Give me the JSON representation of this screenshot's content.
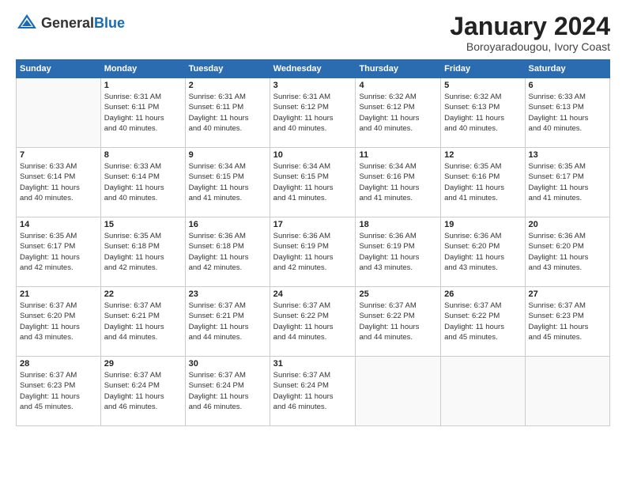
{
  "header": {
    "logo_line1": "General",
    "logo_line2": "Blue",
    "month_title": "January 2024",
    "location": "Boroyaradougou, Ivory Coast"
  },
  "days_of_week": [
    "Sunday",
    "Monday",
    "Tuesday",
    "Wednesday",
    "Thursday",
    "Friday",
    "Saturday"
  ],
  "weeks": [
    [
      {
        "day": "",
        "info": ""
      },
      {
        "day": "1",
        "info": "Sunrise: 6:31 AM\nSunset: 6:11 PM\nDaylight: 11 hours\nand 40 minutes."
      },
      {
        "day": "2",
        "info": "Sunrise: 6:31 AM\nSunset: 6:11 PM\nDaylight: 11 hours\nand 40 minutes."
      },
      {
        "day": "3",
        "info": "Sunrise: 6:31 AM\nSunset: 6:12 PM\nDaylight: 11 hours\nand 40 minutes."
      },
      {
        "day": "4",
        "info": "Sunrise: 6:32 AM\nSunset: 6:12 PM\nDaylight: 11 hours\nand 40 minutes."
      },
      {
        "day": "5",
        "info": "Sunrise: 6:32 AM\nSunset: 6:13 PM\nDaylight: 11 hours\nand 40 minutes."
      },
      {
        "day": "6",
        "info": "Sunrise: 6:33 AM\nSunset: 6:13 PM\nDaylight: 11 hours\nand 40 minutes."
      }
    ],
    [
      {
        "day": "7",
        "info": "Sunrise: 6:33 AM\nSunset: 6:14 PM\nDaylight: 11 hours\nand 40 minutes."
      },
      {
        "day": "8",
        "info": "Sunrise: 6:33 AM\nSunset: 6:14 PM\nDaylight: 11 hours\nand 40 minutes."
      },
      {
        "day": "9",
        "info": "Sunrise: 6:34 AM\nSunset: 6:15 PM\nDaylight: 11 hours\nand 41 minutes."
      },
      {
        "day": "10",
        "info": "Sunrise: 6:34 AM\nSunset: 6:15 PM\nDaylight: 11 hours\nand 41 minutes."
      },
      {
        "day": "11",
        "info": "Sunrise: 6:34 AM\nSunset: 6:16 PM\nDaylight: 11 hours\nand 41 minutes."
      },
      {
        "day": "12",
        "info": "Sunrise: 6:35 AM\nSunset: 6:16 PM\nDaylight: 11 hours\nand 41 minutes."
      },
      {
        "day": "13",
        "info": "Sunrise: 6:35 AM\nSunset: 6:17 PM\nDaylight: 11 hours\nand 41 minutes."
      }
    ],
    [
      {
        "day": "14",
        "info": "Sunrise: 6:35 AM\nSunset: 6:17 PM\nDaylight: 11 hours\nand 42 minutes."
      },
      {
        "day": "15",
        "info": "Sunrise: 6:35 AM\nSunset: 6:18 PM\nDaylight: 11 hours\nand 42 minutes."
      },
      {
        "day": "16",
        "info": "Sunrise: 6:36 AM\nSunset: 6:18 PM\nDaylight: 11 hours\nand 42 minutes."
      },
      {
        "day": "17",
        "info": "Sunrise: 6:36 AM\nSunset: 6:19 PM\nDaylight: 11 hours\nand 42 minutes."
      },
      {
        "day": "18",
        "info": "Sunrise: 6:36 AM\nSunset: 6:19 PM\nDaylight: 11 hours\nand 43 minutes."
      },
      {
        "day": "19",
        "info": "Sunrise: 6:36 AM\nSunset: 6:20 PM\nDaylight: 11 hours\nand 43 minutes."
      },
      {
        "day": "20",
        "info": "Sunrise: 6:36 AM\nSunset: 6:20 PM\nDaylight: 11 hours\nand 43 minutes."
      }
    ],
    [
      {
        "day": "21",
        "info": "Sunrise: 6:37 AM\nSunset: 6:20 PM\nDaylight: 11 hours\nand 43 minutes."
      },
      {
        "day": "22",
        "info": "Sunrise: 6:37 AM\nSunset: 6:21 PM\nDaylight: 11 hours\nand 44 minutes."
      },
      {
        "day": "23",
        "info": "Sunrise: 6:37 AM\nSunset: 6:21 PM\nDaylight: 11 hours\nand 44 minutes."
      },
      {
        "day": "24",
        "info": "Sunrise: 6:37 AM\nSunset: 6:22 PM\nDaylight: 11 hours\nand 44 minutes."
      },
      {
        "day": "25",
        "info": "Sunrise: 6:37 AM\nSunset: 6:22 PM\nDaylight: 11 hours\nand 44 minutes."
      },
      {
        "day": "26",
        "info": "Sunrise: 6:37 AM\nSunset: 6:22 PM\nDaylight: 11 hours\nand 45 minutes."
      },
      {
        "day": "27",
        "info": "Sunrise: 6:37 AM\nSunset: 6:23 PM\nDaylight: 11 hours\nand 45 minutes."
      }
    ],
    [
      {
        "day": "28",
        "info": "Sunrise: 6:37 AM\nSunset: 6:23 PM\nDaylight: 11 hours\nand 45 minutes."
      },
      {
        "day": "29",
        "info": "Sunrise: 6:37 AM\nSunset: 6:24 PM\nDaylight: 11 hours\nand 46 minutes."
      },
      {
        "day": "30",
        "info": "Sunrise: 6:37 AM\nSunset: 6:24 PM\nDaylight: 11 hours\nand 46 minutes."
      },
      {
        "day": "31",
        "info": "Sunrise: 6:37 AM\nSunset: 6:24 PM\nDaylight: 11 hours\nand 46 minutes."
      },
      {
        "day": "",
        "info": ""
      },
      {
        "day": "",
        "info": ""
      },
      {
        "day": "",
        "info": ""
      }
    ]
  ]
}
